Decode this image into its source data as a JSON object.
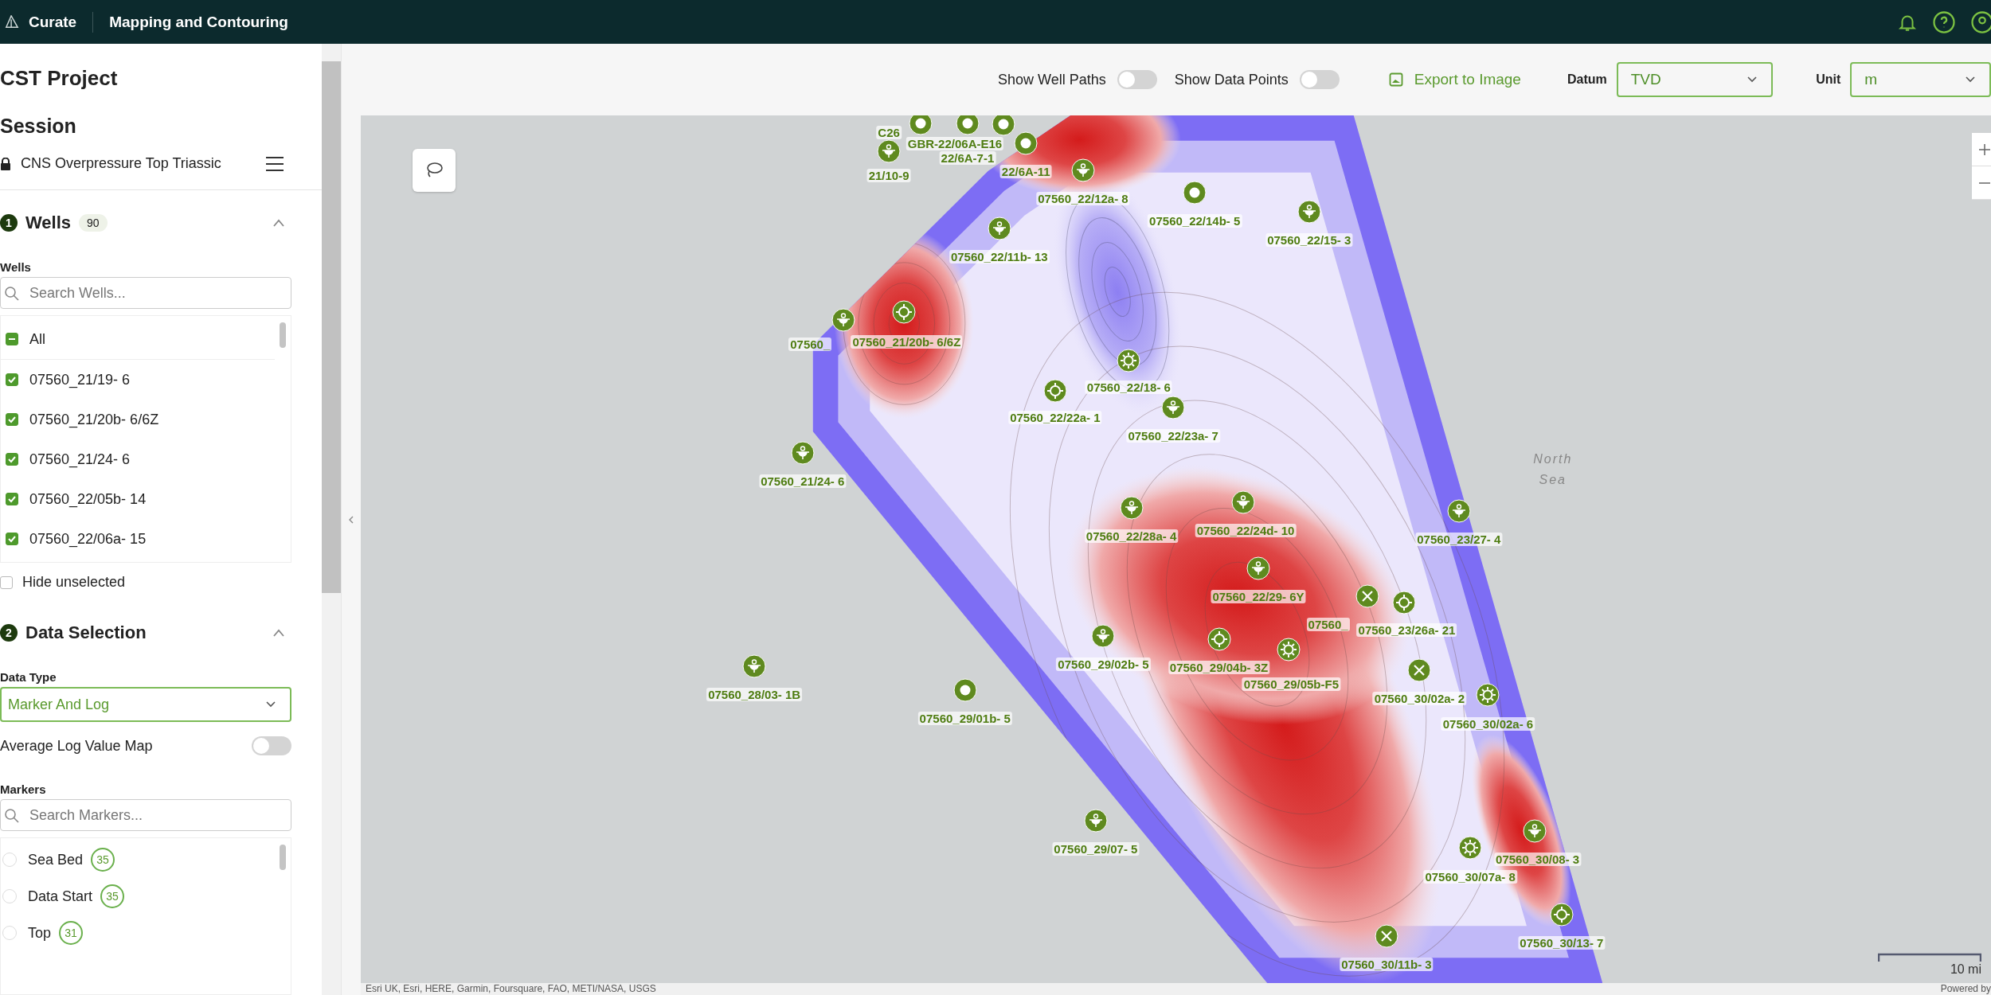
{
  "app_bar": {
    "product": "Curate",
    "page": "Mapping and Contouring"
  },
  "sidebar": {
    "project": "CST Project",
    "session_heading": "Session",
    "session": {
      "name": "CNS Overpressure Top Triassic",
      "locked": true
    },
    "wells_section": {
      "step": "1",
      "title": "Wells",
      "count": "90",
      "expanded": true,
      "field_label": "Wells",
      "search_placeholder": "Search Wells...",
      "all": {
        "label": "All",
        "indeterminate": true
      },
      "items": [
        {
          "label": "07560_21/19- 6",
          "checked": true
        },
        {
          "label": "07560_21/20b- 6/6Z",
          "checked": true
        },
        {
          "label": "07560_21/24- 6",
          "checked": true
        },
        {
          "label": "07560_22/05b- 14",
          "checked": true
        },
        {
          "label": "07560_22/06a- 15",
          "checked": true
        }
      ],
      "hide_unselected": {
        "label": "Hide unselected",
        "checked": false
      }
    },
    "data_section": {
      "step": "2",
      "title": "Data Selection",
      "expanded": true,
      "data_type": {
        "label": "Data Type",
        "value": "Marker And Log"
      },
      "average_toggle": {
        "label": "Average Log Value Map",
        "on": false
      },
      "markers": {
        "label": "Markers",
        "search_placeholder": "Search Markers...",
        "items": [
          {
            "label": "Sea Bed",
            "count": "35",
            "selected": false
          },
          {
            "label": "Data Start",
            "count": "35",
            "selected": false
          },
          {
            "label": "Top",
            "count": "31",
            "selected": false
          }
        ]
      }
    }
  },
  "toolbar": {
    "toggles": [
      {
        "label": "Show Well Paths",
        "on": false
      },
      {
        "label": "Show Data Points",
        "on": false
      }
    ],
    "export": "Export to Image",
    "datum": {
      "label": "Datum",
      "value": "TVD"
    },
    "unit": {
      "label": "Unit",
      "value": "m"
    }
  },
  "map": {
    "region_label": "North Sea",
    "wells": [
      {
        "name": "C26",
        "kind": "ring"
      },
      {
        "name": "GBR-22/06A-E16",
        "kind": "ring"
      },
      {
        "name": "22/6A-7-1",
        "kind": "ring"
      },
      {
        "name": "21/10-9",
        "kind": "drop"
      },
      {
        "name": "22/6A-11",
        "kind": "ring"
      },
      {
        "name": "07560_22/12a- 8",
        "kind": "drop"
      },
      {
        "name": "07560_22/14b- 5",
        "kind": "ring"
      },
      {
        "name": "07560_22/15- 3",
        "kind": "drop"
      },
      {
        "name": "07560_22/11b- 13",
        "kind": "drop"
      },
      {
        "name": "07560_",
        "kind": "drop"
      },
      {
        "name": "07560_21/20b- 6/6Z",
        "kind": "target"
      },
      {
        "name": "07560_22/18- 6",
        "kind": "gear"
      },
      {
        "name": "07560_22/22a- 1",
        "kind": "target"
      },
      {
        "name": "07560_22/23a- 7",
        "kind": "drop"
      },
      {
        "name": "07560_21/24- 6",
        "kind": "drop"
      },
      {
        "name": "07560_22/28a- 4",
        "kind": "drop"
      },
      {
        "name": "07560_22/24d- 10",
        "kind": "drop"
      },
      {
        "name": "07560_23/27- 4",
        "kind": "drop"
      },
      {
        "name": "07560_22/29- 6Y",
        "kind": "drop"
      },
      {
        "name": "07560_",
        "kind": "cross"
      },
      {
        "name": "07560_23/26a- 21",
        "kind": "target"
      },
      {
        "name": "07560_29/02b- 5",
        "kind": "drop"
      },
      {
        "name": "07560_29/04b- 3Z",
        "kind": "target"
      },
      {
        "name": "07560_29/05b-F5",
        "kind": "gear"
      },
      {
        "name": "07560_30/02a- 2",
        "kind": "cross"
      },
      {
        "name": "07560_30/02a- 6",
        "kind": "gear"
      },
      {
        "name": "07560_28/03- 1B",
        "kind": "drop"
      },
      {
        "name": "07560_29/01b- 5",
        "kind": "ring"
      },
      {
        "name": "07560_29/07- 5",
        "kind": "drop"
      },
      {
        "name": "07560_30/07a- 8",
        "kind": "gear"
      },
      {
        "name": "07560_30/08- 3",
        "kind": "drop"
      },
      {
        "name": "07560_30/11b- 3",
        "kind": "cross"
      },
      {
        "name": "07560_30/13- 7",
        "kind": "target"
      }
    ],
    "scale": "10 mi",
    "attribution": "Esri UK, Esri, HERE, Garmin, Foursquare, FAO, METI/NASA, USGS",
    "powered_by": "Powered by"
  }
}
